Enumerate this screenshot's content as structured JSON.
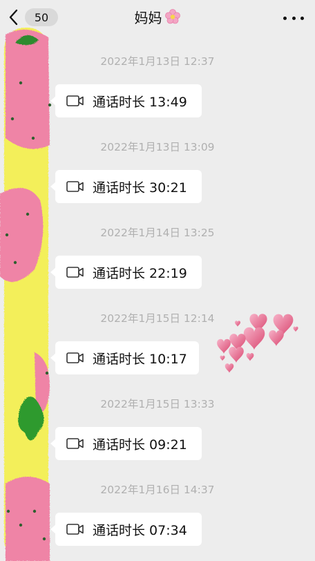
{
  "header": {
    "unread_count": "50",
    "title": "妈妈"
  },
  "messages": [
    {
      "timestamp": "2022年1月13日 12:37",
      "label": "通话时长 13:49"
    },
    {
      "timestamp": "2022年1月13日 13:09",
      "label": "通话时长 30:21"
    },
    {
      "timestamp": "2022年1月14日 13:25",
      "label": "通话时长 22:19"
    },
    {
      "timestamp": "2022年1月15日 12:14",
      "label": "通话时长 10:17"
    },
    {
      "timestamp": "2022年1月15日 13:33",
      "label": "通话时长 09:21"
    },
    {
      "timestamp": "2022年1月16日 14:37",
      "label": "通话时长 07:34"
    }
  ],
  "icons": {
    "back": "chevron-left-icon",
    "more": "more-dots-icon",
    "title_emoji": "flower-icon",
    "call": "video-camera-icon",
    "decoration": "hearts-sticker"
  },
  "colors": {
    "background": "#ededed",
    "bubble": "#ffffff",
    "timestamp": "#b0b0b0",
    "strip_yellow": "#f3ef5a",
    "strip_pink": "#ef84a6"
  }
}
